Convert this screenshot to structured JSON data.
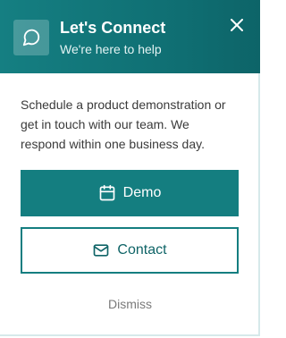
{
  "header": {
    "title": "Let's Connect",
    "subtitle": "We're here to help",
    "icon": "chat-bubble-icon",
    "close_icon": "close-icon"
  },
  "body": {
    "message": "Schedule a product demonstration or get in touch with our team. We respond within one business day."
  },
  "actions": {
    "demo": {
      "label": "Demo",
      "icon": "calendar-icon"
    },
    "contact": {
      "label": "Contact",
      "icon": "mail-icon"
    },
    "dismiss": {
      "label": "Dismiss"
    }
  },
  "colors": {
    "accent": "#147e80",
    "header_bg": "#0f6e72",
    "text": "#3a3a3a",
    "muted": "#7a7a7a"
  }
}
